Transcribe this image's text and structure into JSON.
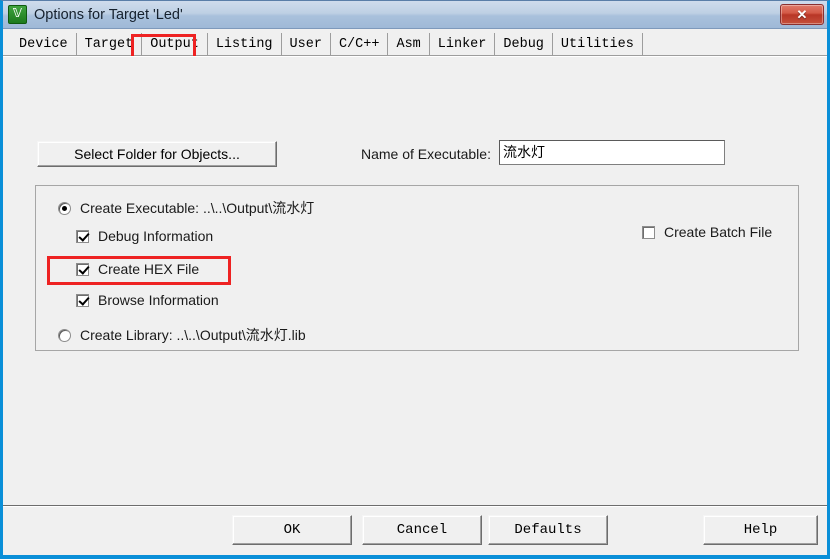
{
  "window": {
    "title": "Options for Target 'Led'",
    "icon": "keil-uvision-icon",
    "close_label": "✕",
    "border_color": "#0a8fd8"
  },
  "tabs": [
    {
      "label": "Device",
      "active": false
    },
    {
      "label": "Target",
      "active": false
    },
    {
      "label": "Output",
      "active": true
    },
    {
      "label": "Listing",
      "active": false
    },
    {
      "label": "User",
      "active": false
    },
    {
      "label": "C/C++",
      "active": false
    },
    {
      "label": "Asm",
      "active": false
    },
    {
      "label": "Linker",
      "active": false
    },
    {
      "label": "Debug",
      "active": false
    },
    {
      "label": "Utilities",
      "active": false
    }
  ],
  "output": {
    "select_folder_label": "Select Folder for Objects...",
    "executable_name_label": "Name of Executable:",
    "executable_name_value": "流水灯",
    "create_executable_label": "Create Executable:  ..\\..\\Output\\流水灯",
    "create_executable_checked": true,
    "debug_information_label": "Debug Information",
    "debug_information_checked": true,
    "create_hex_label": "Create HEX File",
    "create_hex_checked": true,
    "browse_information_label": "Browse Information",
    "browse_information_checked": true,
    "create_library_label": "Create Library:  ..\\..\\Output\\流水灯.lib",
    "create_library_checked": false,
    "create_batch_label": "Create Batch File",
    "create_batch_checked": false
  },
  "annotations": {
    "color": "#ee2222",
    "targets": [
      "tab-output",
      "create-hex-file-checkbox"
    ]
  },
  "buttons": {
    "ok": "OK",
    "cancel": "Cancel",
    "defaults": "Defaults",
    "help": "Help"
  }
}
